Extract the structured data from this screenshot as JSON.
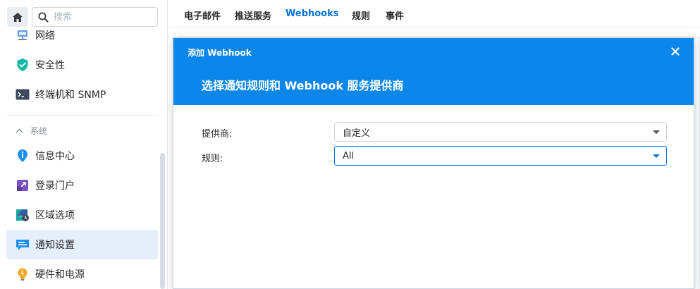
{
  "sidebar": {
    "search_placeholder": "搜索",
    "items_top": [
      {
        "label": "网络",
        "icon": "network-icon"
      },
      {
        "label": "安全性",
        "icon": "shield-icon"
      },
      {
        "label": "终端机和 SNMP",
        "icon": "terminal-icon"
      }
    ],
    "section_label": "系统",
    "items_system": [
      {
        "label": "信息中心",
        "icon": "info-icon"
      },
      {
        "label": "登录门户",
        "icon": "login-portal-icon"
      },
      {
        "label": "区域选项",
        "icon": "region-icon"
      },
      {
        "label": "通知设置",
        "icon": "notification-icon",
        "active": true
      },
      {
        "label": "硬件和电源",
        "icon": "lightbulb-icon"
      }
    ]
  },
  "tabs": [
    {
      "label": "电子邮件"
    },
    {
      "label": "推送服务"
    },
    {
      "label": "Webhooks",
      "active": true
    },
    {
      "label": "规则"
    },
    {
      "label": "事件"
    }
  ],
  "dialog": {
    "title": "添加 Webhook",
    "subtitle": "选择通知规则和 Webhook 服务提供商",
    "provider_label": "提供商:",
    "provider_value": "自定义",
    "rule_label": "规则:",
    "rule_value": "All"
  },
  "colors": {
    "accent": "#0b86ea",
    "tab_active": "#0a73d9",
    "sidebar_active_bg": "#e5eefb"
  }
}
